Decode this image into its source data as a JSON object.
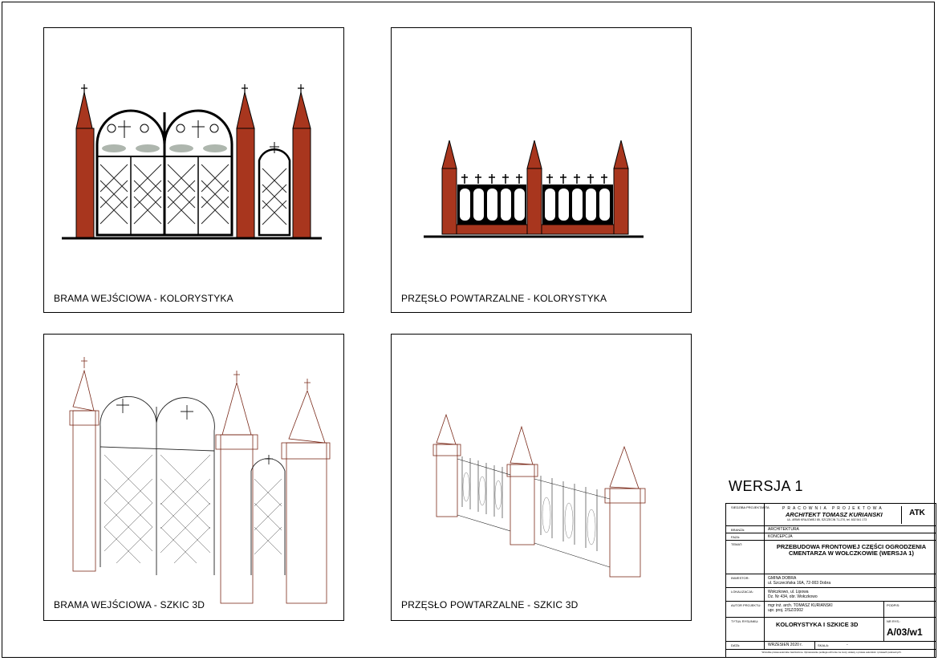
{
  "sheet": {
    "version_label": "WERSJA 1"
  },
  "panels": [
    {
      "caption": "BRAMA WEJŚCIOWA - KOLORYSTYKA"
    },
    {
      "caption": "PRZĘSŁO POWTARZALNE - KOLORYSTYKA"
    },
    {
      "caption": "BRAMA WEJŚCIOWA - SZKIC 3D"
    },
    {
      "caption": "PRZĘSŁO POWTARZALNE - SZKIC 3D"
    }
  ],
  "title_block": {
    "office_label": "SIEDZIBA PROJEKTANTA",
    "office_line1": "PRACOWNIA PROJEKTOWA",
    "office_line2": "ARCHITEKT TOMASZ KURIANSKI",
    "office_line3": "UL. ARMII KRAJOWEJ 85, SZCZECIN 71-270, tel. 602 541 173",
    "logo": "ATK",
    "branza_label": "BRANŻA:",
    "branza": "ARCHITEKTURA",
    "faza_label": "FAZA:",
    "faza": "KONCEPCJA",
    "temat_label": "TEMAT:",
    "temat": "PRZEBUDOWA FRONTOWEJ CZĘŚCI OGRODZENIA CMENTARZA W WOŁCZKOWIE (WERSJA 1)",
    "inwestor_label": "INWESTOR:",
    "inwestor1": "GMINA DOBRA",
    "inwestor2": "ul. Szczecińska 16A, 72-003 Dobra",
    "lokalizacja_label": "LOKALIZACJA:",
    "lokalizacja1": "Wołczkowo, ul. Lipowa",
    "lokalizacja2": "Dz. Nr 434, obr. Wołczkowo",
    "autor_label": "AUTOR PROJEKTU:",
    "autor1": "mgr inż. arch. TOMASZ KURIAŃSKI",
    "autor2": "upr. proj. 2/SZ/2002",
    "podpis_label": "PODPIS:",
    "tytul_label": "TYTUŁ RYSUNKU:",
    "tytul": "KOLORYSTYKA I SZKICE 3D",
    "nr_label": "NR RYS.:",
    "nr": "A/03/w1",
    "data_label": "DATA:",
    "data": "WRZESIEŃ 2020 r.",
    "skala_label": "SKALA:",
    "skala": "-",
    "footer": "Wszelkie prawa autorskie zastrzeżone. Opracowanie podlega ochronie na mocy ustawy o prawie autorskim i prawach pokrewnych."
  }
}
